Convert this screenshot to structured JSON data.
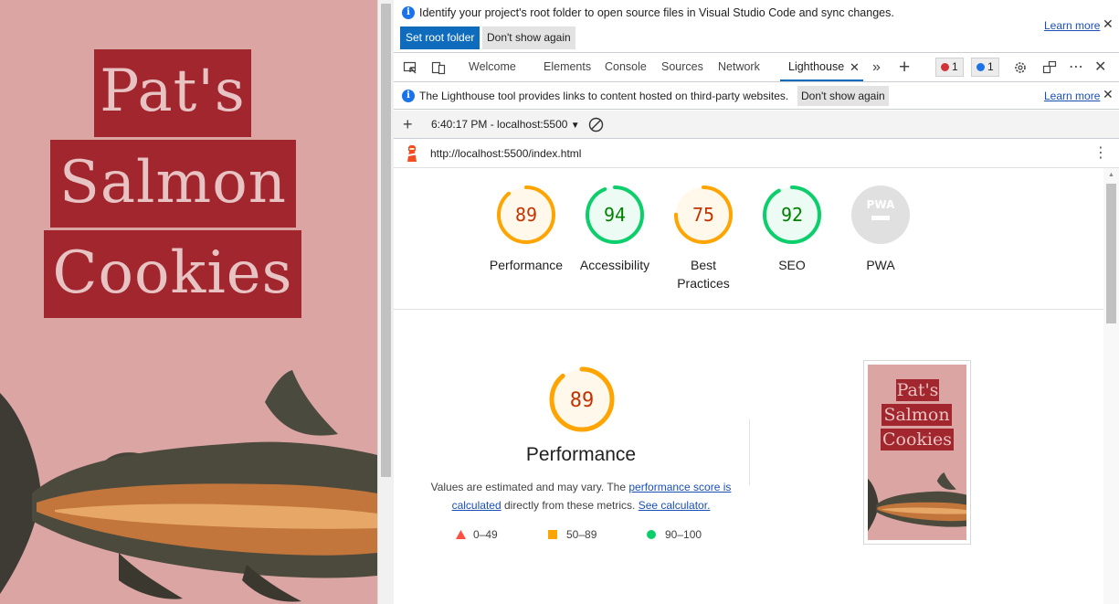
{
  "page": {
    "title_lines": [
      "Pat's",
      "Salmon",
      "Cookies"
    ],
    "bg_color": "#dba5a4",
    "title_bg_color": "#a1262d"
  },
  "infobar_vscode": {
    "icon": "info-icon",
    "message": "Identify your project's root folder to open source files in Visual Studio Code and sync changes.",
    "primary_button": "Set root folder",
    "secondary_button": "Don't show again",
    "learn_more": "Learn more"
  },
  "tabs": {
    "items": [
      "Welcome",
      "Elements",
      "Console",
      "Sources",
      "Network",
      "Lighthouse"
    ],
    "active": "Lighthouse",
    "errors_count": "1",
    "issues_count": "1"
  },
  "infobar_lighthouse": {
    "icon": "info-icon",
    "message": "The Lighthouse tool provides links to content hosted on third-party websites.",
    "button": "Don't show again",
    "learn_more": "Learn more"
  },
  "report_toolbar": {
    "selected_report": "6:40:17 PM - localhost:5500"
  },
  "url": "http://localhost:5500/index.html",
  "scores": [
    {
      "label": "Performance",
      "value": 89,
      "status": "average"
    },
    {
      "label": "Accessibility",
      "value": 94,
      "status": "pass"
    },
    {
      "label": "Best Practices",
      "value": 75,
      "status": "average"
    },
    {
      "label": "SEO",
      "value": 92,
      "status": "pass"
    },
    {
      "label": "PWA",
      "value": null,
      "status": "na",
      "badge": "PWA"
    }
  ],
  "performance": {
    "score": "89",
    "title": "Performance",
    "desc_before": "Values are estimated and may vary. The ",
    "desc_link": "performance score is calculated",
    "desc_middle": " directly from these metrics. ",
    "desc_link2": "See calculator.",
    "legend": [
      "0–49",
      "50–89",
      "90–100"
    ]
  },
  "colors": {
    "pass": "#0cce6b",
    "pass_text": "#008000",
    "average": "#ffa400",
    "average_text": "#c33300",
    "fail": "#ff4e42",
    "accent": "#0f6cbd"
  }
}
